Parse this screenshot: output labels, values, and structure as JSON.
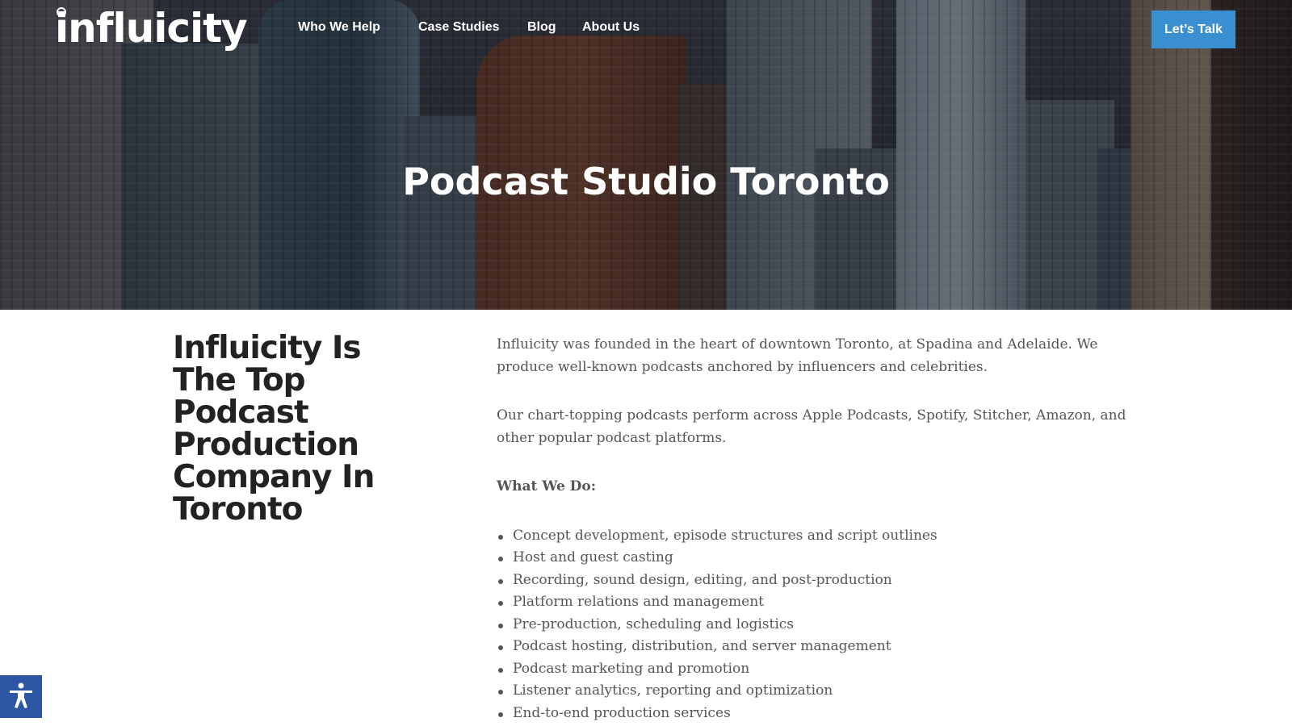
{
  "header": {
    "logo": "influicity",
    "nav": [
      "Who We Help",
      "Case Studies",
      "Blog",
      "About Us"
    ],
    "cta_label": "Let’s Talk"
  },
  "hero": {
    "title": "Podcast Studio Toronto"
  },
  "main": {
    "heading": "Influicity Is The Top Podcast Production Company In Toronto",
    "paragraphs": [
      "Influicity was founded in the heart of downtown Toronto, at Spadina and Adelaide. We produce well-known podcasts anchored by influencers and celebrities.",
      "Our chart-topping podcasts perform across Apple Podcasts, Spotify, Stitcher, Amazon, and other popular podcast platforms."
    ],
    "what_we_do_label": "What We Do:",
    "services": [
      "Concept development, episode structures and script outlines",
      "Host and guest casting",
      "Recording, sound design, editing, and post-production",
      "Platform relations and management",
      "Pre-production, scheduling and logistics",
      "Podcast hosting, distribution, and server management",
      "Podcast marketing and promotion",
      "Listener analytics, reporting and optimization",
      "End-to-end production services"
    ]
  },
  "accessibility": {
    "icon": "accessibility-icon",
    "color": "#2d56a5"
  },
  "colors": {
    "accent": "#3a8fd0",
    "heading": "#222222",
    "body_text": "#555555"
  }
}
